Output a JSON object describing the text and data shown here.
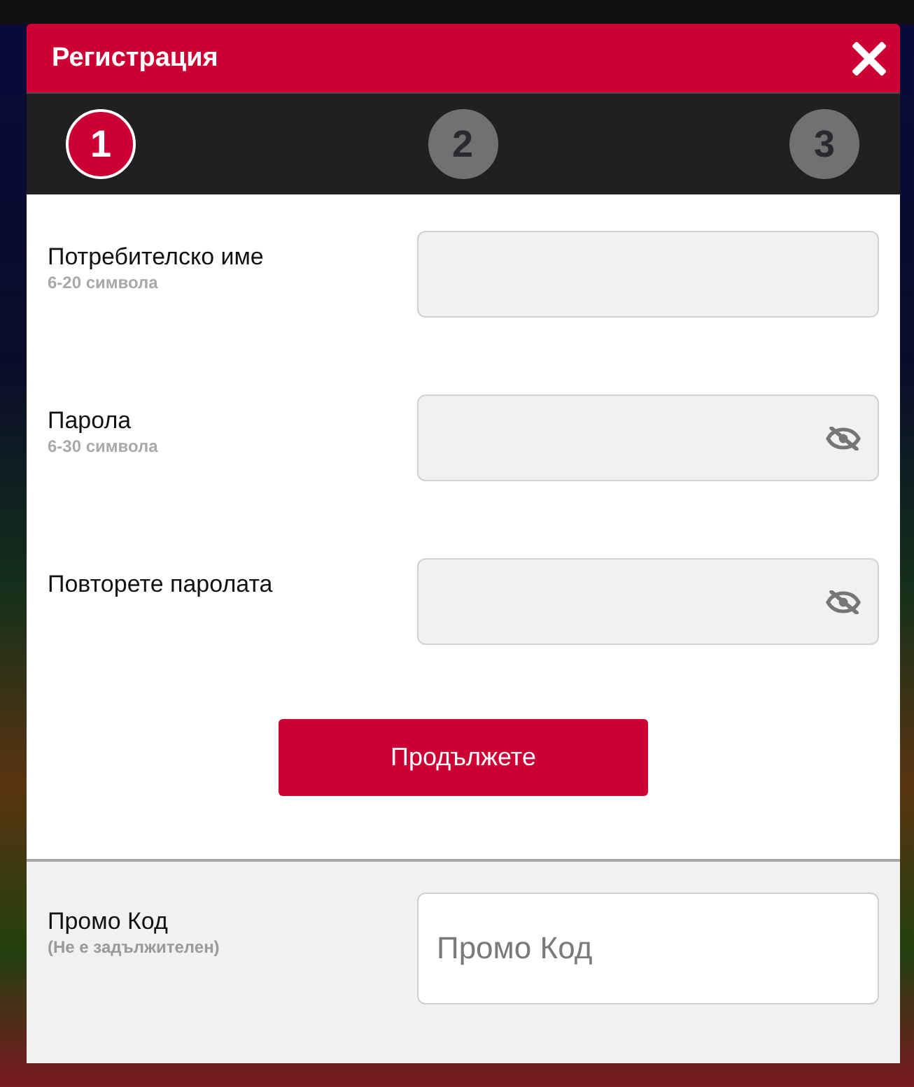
{
  "dialog": {
    "title": "Регистрация"
  },
  "steps": [
    {
      "number": "1",
      "selected": true
    },
    {
      "number": "2",
      "selected": false
    },
    {
      "number": "3",
      "selected": false
    }
  ],
  "fields": [
    {
      "kind": "text",
      "label": "Потребителско име",
      "hint": "6-20 символа"
    },
    {
      "kind": "password",
      "label": "Парола",
      "hint": "6-30 символа"
    },
    {
      "kind": "password",
      "label": "Повторете паролата"
    }
  ],
  "submit_button": "Продължете",
  "promo": {
    "label": "Промо Код",
    "hint": "(Не е задължителен)",
    "placeholder": "Промо Код"
  }
}
